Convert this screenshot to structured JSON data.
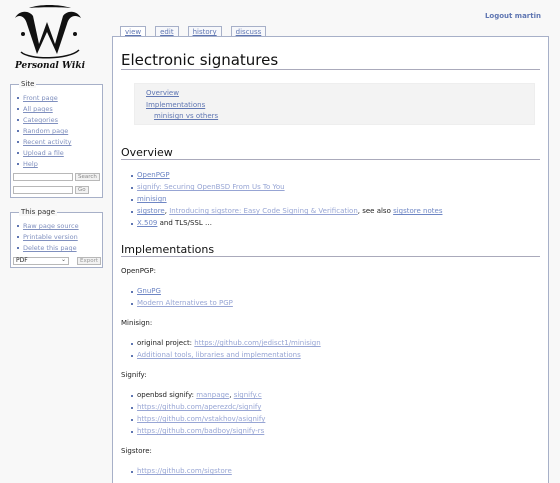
{
  "logo": {
    "text": "Personal Wiki"
  },
  "userbar": {
    "logout": "Logout martin"
  },
  "tabs": [
    {
      "label": "view",
      "selected": true
    },
    {
      "label": "edit",
      "selected": false
    },
    {
      "label": "history",
      "selected": false
    },
    {
      "label": "discuss",
      "selected": false
    }
  ],
  "site": {
    "title": "Site",
    "items": [
      "Front page",
      "All pages",
      "Categories",
      "Random page",
      "Recent activity",
      "Upload a file",
      "Help"
    ],
    "search_button": "Search",
    "go_button": "Go"
  },
  "this_page": {
    "title": "This page",
    "items": [
      "Raw page source",
      "Printable version",
      "Delete this page"
    ],
    "export_format": "PDF",
    "export_button": "Export"
  },
  "page": {
    "title": "Electronic signatures",
    "toc": [
      "Overview",
      "Implementations",
      "minisign vs others"
    ],
    "overview_heading": "Overview",
    "overview": {
      "l1": "OpenPGP",
      "l2": "signify: Securing OpenBSD From Us To You",
      "l3": "minisign",
      "l4a": "sigstore",
      "l4sep": ", ",
      "l4b": "Introducing sigstore: Easy Code Signing & Verification",
      "l4c": ", see also ",
      "l4d": "sigstore notes",
      "l5a": "X.509",
      "l5b": " and TLS/SSL …"
    },
    "impl_heading": "Implementations",
    "openpgp_label": "OpenPGP:",
    "openpgp": [
      "GnuPG",
      "Modern Alternatives to PGP"
    ],
    "minisign_label": "Minisign:",
    "minisign": {
      "orig_prefix": "original project: ",
      "orig_link": "https://github.com/jedisct1/minisign",
      "tools": "Additional tools, libraries and implementations"
    },
    "signify_label": "Signify:",
    "signify": {
      "openbsd_prefix": "openbsd signify: ",
      "manpage": "manpage",
      "sep": ", ",
      "signify_c": "signify.c",
      "links": [
        "https://github.com/aperezdc/signify",
        "https://github.com/vstakhov/asignify",
        "https://github.com/badboy/signify-rs"
      ]
    },
    "sigstore_label": "Sigstore:",
    "sigstore": [
      "https://github.com/sigstore"
    ]
  }
}
